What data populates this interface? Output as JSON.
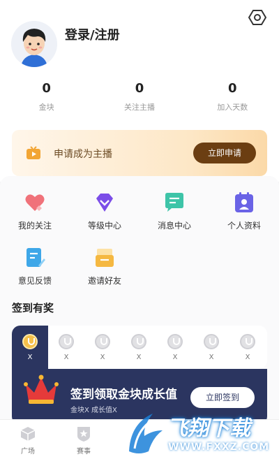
{
  "header": {
    "login_label": "登录/注册"
  },
  "stats": [
    {
      "value": "0",
      "label": "金块"
    },
    {
      "value": "0",
      "label": "关注主播"
    },
    {
      "value": "0",
      "label": "加入天数"
    }
  ],
  "apply": {
    "text": "申请成为主播",
    "button": "立即申请"
  },
  "grid": [
    {
      "label": "我的关注",
      "icon": "heart-icon"
    },
    {
      "label": "等级中心",
      "icon": "diamond-icon"
    },
    {
      "label": "消息中心",
      "icon": "message-icon"
    },
    {
      "label": "个人资料",
      "icon": "profile-icon"
    },
    {
      "label": "意见反馈",
      "icon": "feedback-icon"
    },
    {
      "label": "邀请好友",
      "icon": "envelope-icon"
    }
  ],
  "checkin": {
    "title": "签到有奖",
    "days": [
      "X",
      "X",
      "X",
      "X",
      "X",
      "X",
      "X"
    ],
    "banner_title": "签到领取金块成长值",
    "banner_sub": "金块X 成长值X",
    "button": "立即签到"
  },
  "tabs": [
    {
      "label": "广场"
    },
    {
      "label": "赛事"
    }
  ],
  "watermark": {
    "title": "飞翔下载",
    "url": "WWW.FXXZ.COM"
  },
  "colors": {
    "accent_brown": "#6b3e12",
    "navy": "#2b3560",
    "coin_gold": "#f5c04a"
  }
}
